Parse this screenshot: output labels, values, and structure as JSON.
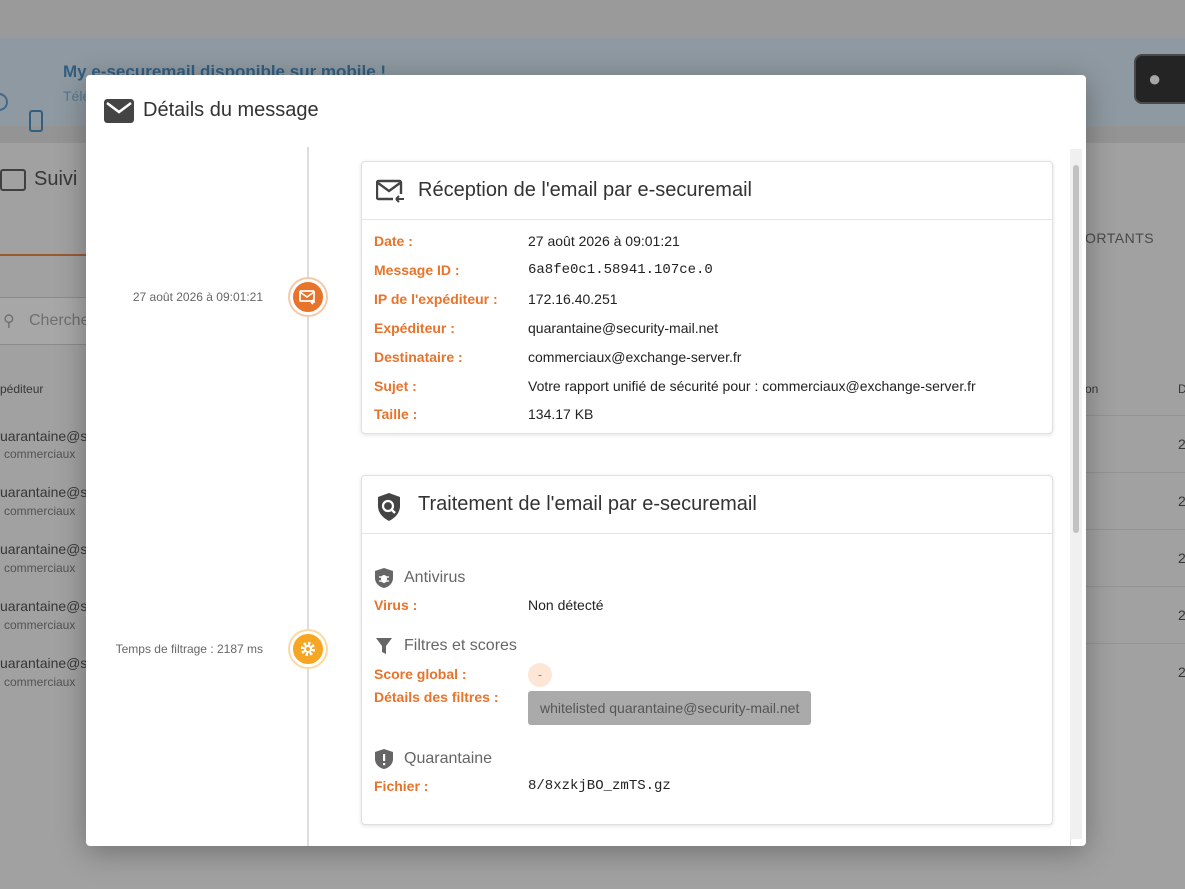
{
  "background": {
    "banner_title": "My e-securemail disponible sur mobile !",
    "banner_sub": "Télé",
    "section": "Suivi",
    "search_placeholder": "Cherche",
    "col_sender": "péditeur",
    "col_right": "on",
    "col_d": "D",
    "tab_right": "ORTANTS",
    "row_sender": "uarantaine@s",
    "row_recipient": "commerciaux",
    "row_num": "2"
  },
  "modal": {
    "title": "Détails du message",
    "timeline": {
      "reception_time": "27 août 2026 à 09:01:21",
      "filtering_time": "Temps de filtrage : 2187 ms"
    },
    "reception": {
      "title": "Réception de l'email par e-securemail",
      "fields": [
        {
          "label": "Date :",
          "value": "27 août 2026 à 09:01:21"
        },
        {
          "label": "Message ID :",
          "value": "6a8fe0c1.58941.107ce.0"
        },
        {
          "label": "IP de l'expéditeur :",
          "value": "172.16.40.251"
        },
        {
          "label": "Expéditeur :",
          "value": "quarantaine@security-mail.net"
        },
        {
          "label": "Destinataire :",
          "value": "commerciaux@exchange-server.fr"
        },
        {
          "label": "Sujet :",
          "value": "Votre rapport unifié de sécurité pour : commerciaux@exchange-server.fr"
        },
        {
          "label": "Taille :",
          "value": "134.17 KB"
        }
      ]
    },
    "treatment": {
      "title": "Traitement de l'email par e-securemail",
      "antivirus": {
        "title": "Antivirus",
        "label": "Virus :",
        "value": "Non détecté"
      },
      "filters": {
        "title": "Filtres et scores",
        "score_label": "Score global :",
        "score_value": "-",
        "details_label": "Détails des filtres :",
        "details_value": "whitelisted quarantaine@security-mail.net"
      },
      "quarantine": {
        "title": "Quarantaine",
        "label": "Fichier :",
        "value": "8/8xzkjBO_zmTS.gz"
      }
    }
  }
}
